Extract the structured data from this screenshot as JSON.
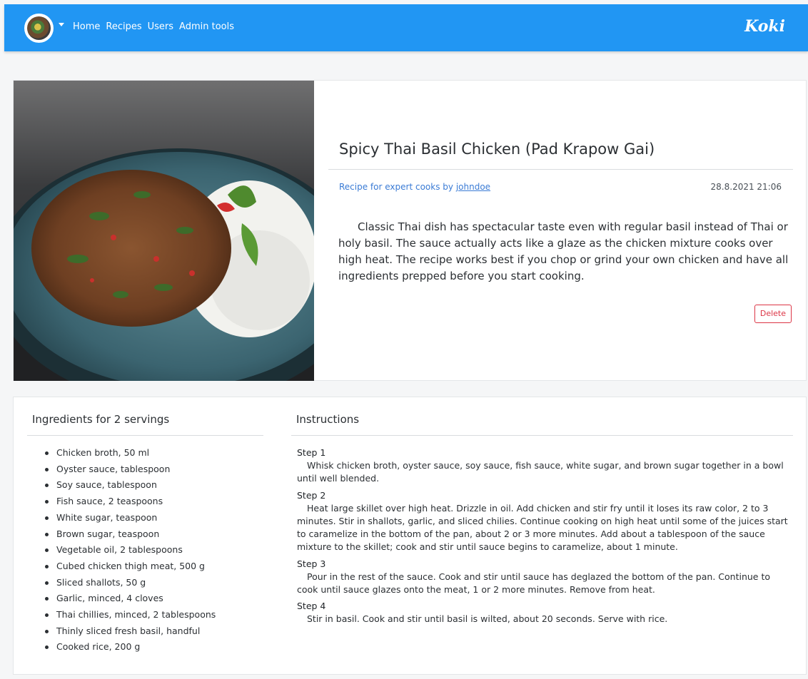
{
  "navbar": {
    "links": [
      "Home",
      "Recipes",
      "Users",
      "Admin tools"
    ],
    "brand": "Koki",
    "background": "#2196f3"
  },
  "recipe": {
    "title": "Spicy Thai Basil Chicken (Pad Krapow Gai)",
    "meta_prefix": "Recipe for expert cooks by ",
    "author": "johndoe",
    "date": "28.8.2021 21:06",
    "description": "Classic Thai dish has spectacular taste even with regular basil instead of Thai or holy basil. The sauce actually acts like a glaze as the chicken mixture cooks over high heat. The recipe works best if you chop or grind your own chicken and have all ingredients prepped before you start cooking.",
    "delete_label": "Delete"
  },
  "ingredients": {
    "heading": "Ingredients for 2 servings",
    "items": [
      "Chicken broth, 50 ml",
      "Oyster sauce, tablespoon",
      "Soy sauce, tablespoon",
      "Fish sauce, 2 teaspoons",
      "White sugar, teaspoon",
      "Brown sugar, teaspoon",
      "Vegetable oil, 2 tablespoons",
      "Cubed chicken thigh meat, 500 g",
      "Sliced shallots, 50 g",
      "Garlic, minced, 4 cloves",
      "Thai chillies, minced, 2 tablespoons",
      "Thinly sliced fresh basil, handful",
      "Cooked rice, 200 g"
    ]
  },
  "instructions": {
    "heading": "Instructions",
    "steps": [
      {
        "title": "Step 1",
        "text": "Whisk chicken broth, oyster sauce, soy sauce, fish sauce, white sugar, and brown sugar together in a bowl until well blended."
      },
      {
        "title": "Step 2",
        "text": "Heat large skillet over high heat. Drizzle in oil. Add chicken and stir fry until it loses its raw color, 2 to 3 minutes. Stir in shallots, garlic, and sliced chilies. Continue cooking on high heat until some of the juices start to caramelize in the bottom of the pan, about 2 or 3 more minutes. Add about a tablespoon of the sauce mixture to the skillet; cook and stir until sauce begins to caramelize, about 1 minute."
      },
      {
        "title": "Step 3",
        "text": "Pour in the rest of the sauce. Cook and stir until sauce has deglazed the bottom of the pan. Continue to cook until sauce glazes onto the meat, 1 or 2 more minutes. Remove from heat."
      },
      {
        "title": "Step 4",
        "text": "Stir in basil. Cook and stir until basil is wilted, about 20 seconds. Serve with rice."
      }
    ]
  }
}
